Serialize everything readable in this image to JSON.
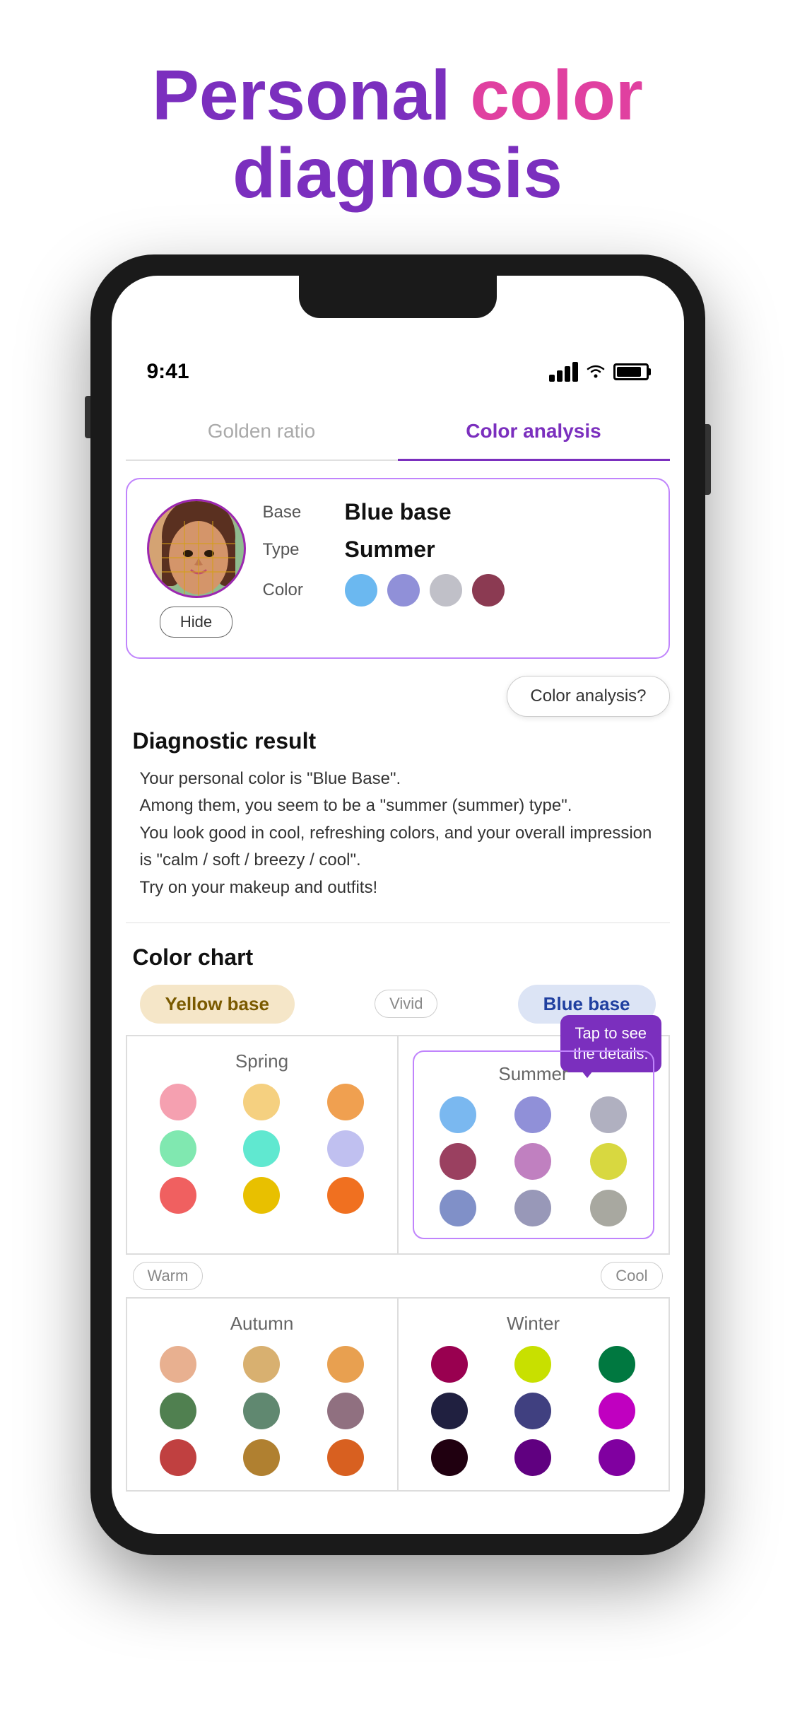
{
  "header": {
    "title_personal": "Personal ",
    "title_color": "color",
    "title_diagnosis": "diagnosis"
  },
  "status_bar": {
    "time": "9:41"
  },
  "tabs": [
    {
      "id": "golden-ratio",
      "label": "Golden ratio",
      "active": false
    },
    {
      "id": "color-analysis",
      "label": "Color analysis",
      "active": true
    }
  ],
  "result_card": {
    "base_label": "Base",
    "base_value": "Blue base",
    "type_label": "Type",
    "type_value": "Summer",
    "color_label": "Color",
    "colors": [
      {
        "hex": "#6bb8f0",
        "name": "light-blue"
      },
      {
        "hex": "#9090d8",
        "name": "medium-blue"
      },
      {
        "hex": "#c0c0c8",
        "name": "silver"
      },
      {
        "hex": "#8b3a52",
        "name": "mauve"
      }
    ],
    "hide_button": "Hide"
  },
  "color_analysis_btn": "Color analysis?",
  "diagnostic": {
    "title": "Diagnostic result",
    "lines": [
      "Your personal color is \"Blue Base\".",
      "Among them, you seem to be a \"summer (summer) type\".",
      "You look good in cool, refreshing colors, and your overall impression is \"calm / soft / breezy / cool\".",
      "Try on your makeup and outfits!"
    ]
  },
  "color_chart": {
    "title": "Color chart",
    "yellow_base": "Yellow base",
    "blue_base": "Blue base",
    "vivid": "Vivid",
    "warm": "Warm",
    "cool": "Cool",
    "tap_tooltip": "Tap to see\nthe details.",
    "spring": {
      "title": "Spring",
      "dots": [
        "#f5a0b0",
        "#f5d080",
        "#f0a050",
        "#80e8b0",
        "#60e8d0",
        "#c0c0f0",
        "#f06060",
        "#e8c000",
        "#f07020"
      ]
    },
    "summer": {
      "title": "Summer",
      "dots": [
        "#7ab8f0",
        "#9090d8",
        "#b0b0c0",
        "#9a4060",
        "#c080c0",
        "#d8d840",
        "#8090c8",
        "#9898b8",
        "#a8a8a0"
      ]
    },
    "autumn": {
      "title": "Autumn",
      "dots": [
        "#e8b090",
        "#d8b070",
        "#e8a050",
        "#508050",
        "#608870",
        "#907080",
        "#c04040",
        "#b08030",
        "#d86020"
      ]
    },
    "winter": {
      "title": "Winter",
      "dots": [
        "#990050",
        "#c8e000",
        "#007840",
        "#202040",
        "#404080",
        "#c000c0",
        "#200010",
        "#600080",
        "#8000a0"
      ]
    }
  }
}
